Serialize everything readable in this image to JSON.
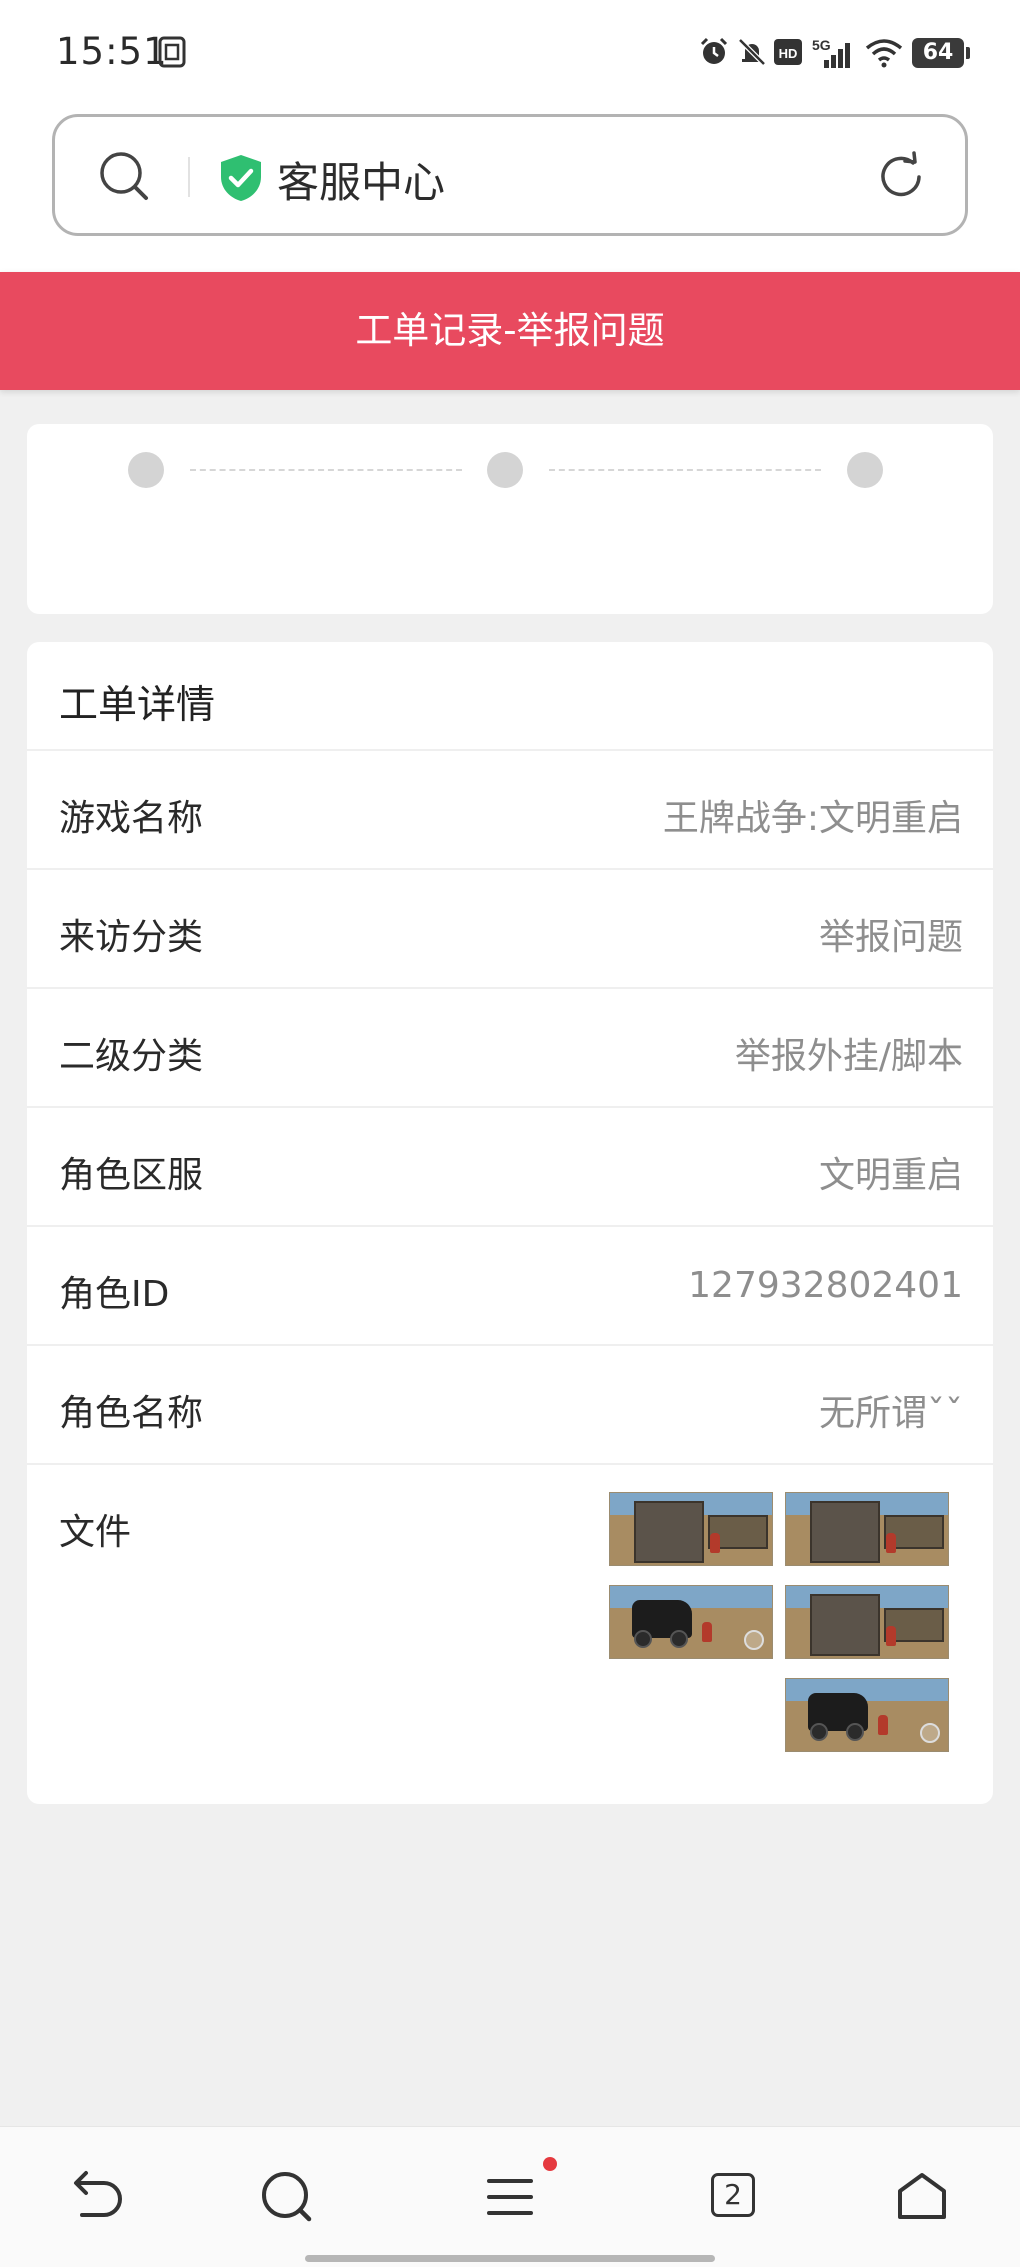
{
  "status_bar": {
    "time": "15:51",
    "battery": "64"
  },
  "address_bar": {
    "title": "客服中心"
  },
  "header": {
    "title": "工单记录-举报问题"
  },
  "progress": {
    "steps": [
      "",
      "",
      ""
    ]
  },
  "detail": {
    "title": "工单详情",
    "rows": [
      {
        "label": "游戏名称",
        "value": "王牌战争:文明重启"
      },
      {
        "label": "来访分类",
        "value": "举报问题"
      },
      {
        "label": "二级分类",
        "value": "举报外挂/脚本"
      },
      {
        "label": "角色区服",
        "value": "文明重启"
      },
      {
        "label": "角色ID",
        "value": "127932802401"
      },
      {
        "label": "角色名称",
        "value": "无所谓ˇˇ"
      }
    ],
    "files_label": "文件",
    "files": [
      "inventory",
      "inventory",
      "vehicle",
      "inventory",
      "vehicle"
    ]
  },
  "bottom_nav": {
    "tab_count": "2",
    "icons": [
      "back-icon",
      "search-icon",
      "menu-icon",
      "tabs-icon",
      "home-icon"
    ]
  },
  "colors": {
    "header_bg": "#e84a5f",
    "shield": "#2fbf71",
    "notification_dot": "#e5393f"
  }
}
